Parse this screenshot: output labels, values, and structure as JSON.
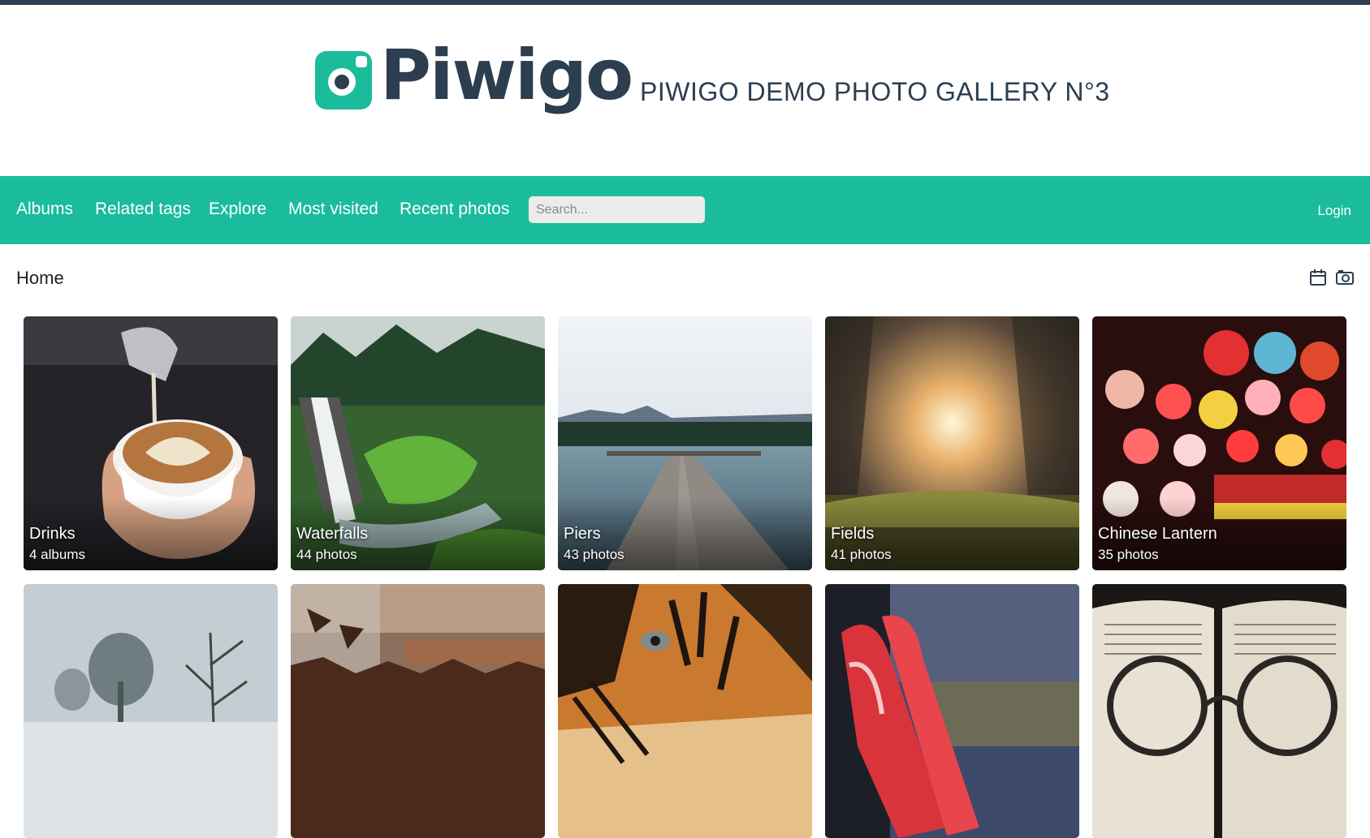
{
  "header": {
    "logo_text": "Piwigo",
    "gallery_title": "PIWIGO DEMO PHOTO GALLERY N°3"
  },
  "nav": {
    "items": [
      "Albums",
      "Related tags",
      "Explore",
      "Most visited",
      "Recent photos"
    ],
    "search_placeholder": "Search...",
    "login": "Login"
  },
  "breadcrumb": {
    "home": "Home"
  },
  "toolbar": {
    "icons": [
      "calendar-icon",
      "camera-icon"
    ]
  },
  "albums": [
    {
      "name": "Drinks",
      "count": "4 albums",
      "image": "latte art coffee cup"
    },
    {
      "name": "Waterfalls",
      "count": "44 photos",
      "image": "waterfall forest"
    },
    {
      "name": "Piers",
      "count": "43 photos",
      "image": "wooden pier lake"
    },
    {
      "name": "Fields",
      "count": "41 photos",
      "image": "sunset field"
    },
    {
      "name": "Chinese Lantern",
      "count": "35 photos",
      "image": "chinese lanterns"
    },
    {
      "name": "",
      "count": "",
      "image": "snowy trees"
    },
    {
      "name": "",
      "count": "",
      "image": "chocolate jar"
    },
    {
      "name": "",
      "count": "",
      "image": "tiger face"
    },
    {
      "name": "",
      "count": "",
      "image": "red high heels"
    },
    {
      "name": "",
      "count": "",
      "image": "book with glasses"
    }
  ],
  "colors": {
    "brand": "#1abc9c",
    "dark": "#2c3e50"
  }
}
